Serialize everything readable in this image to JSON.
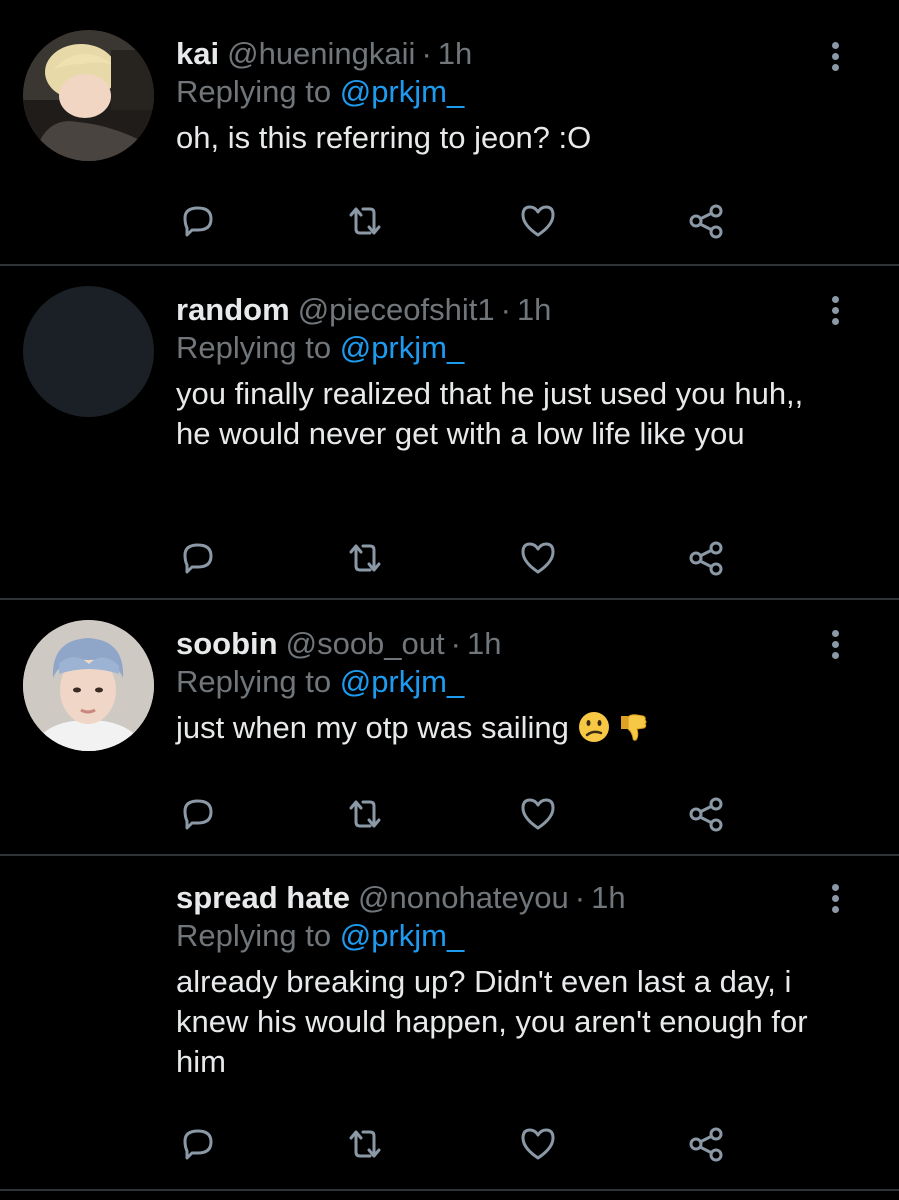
{
  "colors": {
    "background": "#000000",
    "primary_text": "#e7e9ea",
    "secondary_text": "#71767b",
    "link": "#1d9bf0",
    "divider": "#2f3336",
    "icon": "#8b98a5"
  },
  "tweets": [
    {
      "name": "kai",
      "handle": "@hueningkaii",
      "separator": "·",
      "time": "1h",
      "replying_prefix": "Replying to",
      "replying_to": "@prkjm_",
      "text": "oh, is this referring to jeon? :O",
      "avatar": "photo-avatar-blonde"
    },
    {
      "name": "random",
      "handle": "@pieceofshit1",
      "separator": "·",
      "time": "1h",
      "replying_prefix": "Replying to",
      "replying_to": "@prkjm_",
      "text": "you finally realized that he just used you huh,, he would never get with a low life like you",
      "avatar": "default-avatar"
    },
    {
      "name": "soobin",
      "handle": "@soob_out",
      "separator": "·",
      "time": "1h",
      "replying_prefix": "Replying to",
      "replying_to": "@prkjm_",
      "text": "just when my otp was sailing",
      "emojis": [
        "confused-face-emoji",
        "thumbs-down-emoji"
      ],
      "avatar": "photo-avatar-blue-hair"
    },
    {
      "name": "spread hate",
      "handle": "@nonohateyou",
      "separator": "·",
      "time": "1h",
      "replying_prefix": "Replying to",
      "replying_to": "@prkjm_",
      "text": "already breaking up? Didn't even last a day, i knew his would happen, you aren't enough for him",
      "avatar": "none"
    }
  ],
  "action_icons": [
    "reply-icon",
    "retweet-icon",
    "like-icon",
    "share-icon"
  ]
}
